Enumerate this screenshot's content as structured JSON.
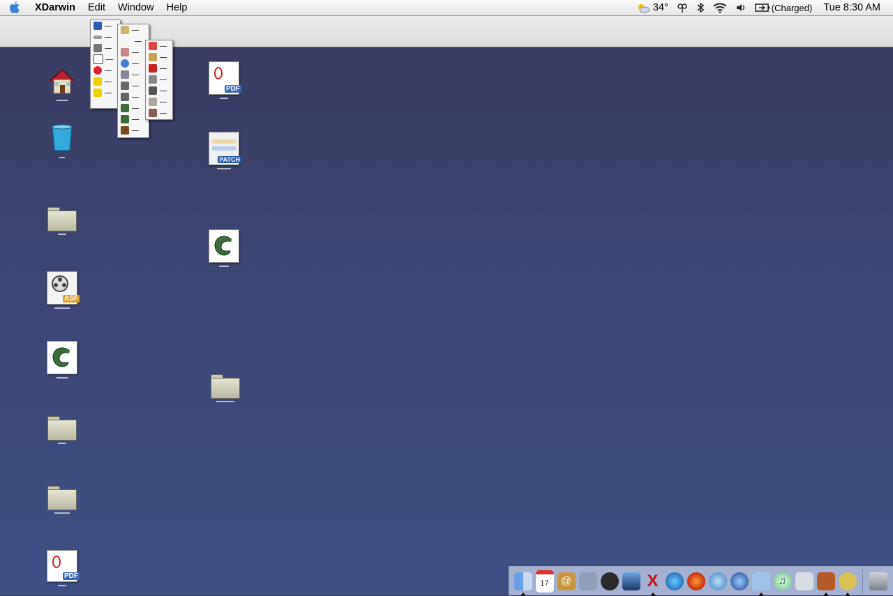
{
  "menubar": {
    "app_name": "XDarwin",
    "menus": [
      "Edit",
      "Window",
      "Help"
    ],
    "status": {
      "temperature": "34°",
      "battery_text": "(Charged)",
      "clock": "Tue 8:30 AM"
    }
  },
  "desktop_icons": [
    {
      "name": "home-icon",
      "type": "home"
    },
    {
      "name": "trash-icon",
      "type": "trash"
    },
    {
      "name": "folder-icon",
      "type": "folder"
    },
    {
      "name": "asf-video-file-icon",
      "type": "doc",
      "badge": "ASF"
    },
    {
      "name": "gimp-file-icon",
      "type": "gimp"
    },
    {
      "name": "folder-icon",
      "type": "folder"
    },
    {
      "name": "folder-icon",
      "type": "folder"
    },
    {
      "name": "pdf-file-icon",
      "type": "doc",
      "badge": "PDF"
    },
    {
      "name": "pdf-file-icon",
      "type": "doc",
      "badge": "PDF"
    },
    {
      "name": "patch-file-icon",
      "type": "doc",
      "badge": "PATCH"
    },
    {
      "name": "gimp-file-icon",
      "type": "gimp"
    },
    {
      "name": "folder-icon",
      "type": "folder"
    }
  ],
  "colors": {
    "desktop_top": "#393a5e",
    "desktop_bottom": "#3f4f86",
    "pdf_badge": "#3b66b0",
    "asf_badge": "#e0a020",
    "patch_badge": "#2a5aa8",
    "gimp_green": "#3e6b3a"
  },
  "dock": {
    "items": [
      "finder-icon",
      "ical-icon",
      "address-book-icon",
      "system-prefs-icon",
      "dashboard-icon",
      "preview-icon",
      "x11-icon",
      "network-icon",
      "firefox-icon",
      "safari-icon",
      "camino-icon",
      "screenshot-icon",
      "itunes-icon",
      "apple-icon",
      "terminal-icon",
      "gimp-dock-icon"
    ],
    "trash": "dock-trash-icon"
  }
}
